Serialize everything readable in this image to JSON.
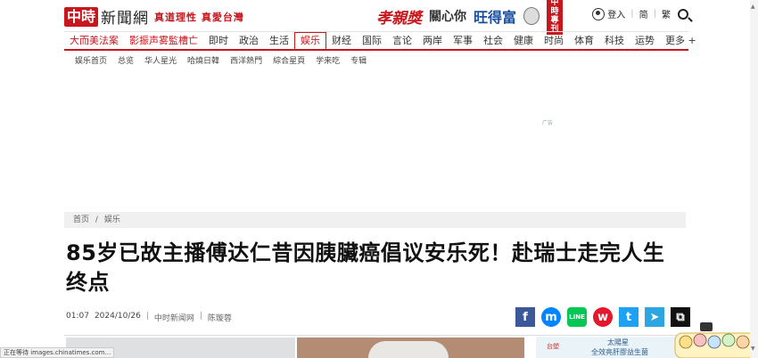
{
  "header": {
    "logo_box": "中時",
    "logo_text": "新聞網",
    "slogan": "真道理性 真愛台灣",
    "brands": [
      "孝親獎",
      "關心你",
      "旺得富",
      "",
      "中時 專刊"
    ],
    "login_label": "登入",
    "lang_simplified": "简",
    "lang_traditional": "繁"
  },
  "nav": {
    "items": [
      {
        "label": "大而美法案",
        "hot": true
      },
      {
        "label": "影振声雾監槽亡",
        "hot": true
      },
      {
        "label": "即时"
      },
      {
        "label": "政治"
      },
      {
        "label": "生活"
      },
      {
        "label": "娱乐",
        "active": true
      },
      {
        "label": "财经"
      },
      {
        "label": "国际"
      },
      {
        "label": "言论"
      },
      {
        "label": "两岸"
      },
      {
        "label": "军事"
      },
      {
        "label": "社会"
      },
      {
        "label": "健康"
      },
      {
        "label": "时尚"
      },
      {
        "label": "体育"
      },
      {
        "label": "科技"
      },
      {
        "label": "运势"
      }
    ],
    "more_label": "更多 +"
  },
  "subnav": [
    "娱乐首页",
    "总览",
    "华人星光",
    "哈燒日韓",
    "西洋熱門",
    "綜合星頁",
    "学来吃",
    "专辑"
  ],
  "ad_label": "广告",
  "breadcrumb": {
    "home": "首页",
    "sep": "/",
    "section": "娱乐"
  },
  "article": {
    "title": "85岁已故主播傅达仁昔因胰臟癌倡议安乐死！赴瑞士走完人生终点",
    "time": "01:07",
    "date": "2024/10/26",
    "source": "中时新闻网",
    "author": "陈璇蓉"
  },
  "share": {
    "facebook": "f",
    "messenger": "m",
    "line": "LINE",
    "weibo": "w",
    "twitter": "t",
    "telegram": "➤",
    "copy": "⧉"
  },
  "side_ad": {
    "brand": "台塑",
    "line1": "太陽星",
    "line2": "全效亮肝膠益生菌"
  },
  "status_bar": "正在等待 images.chinatimes.com...",
  "colors": {
    "brand_red": "#c8161d",
    "facebook": "#3b5998",
    "line": "#06c755",
    "twitter": "#1da1f2"
  }
}
